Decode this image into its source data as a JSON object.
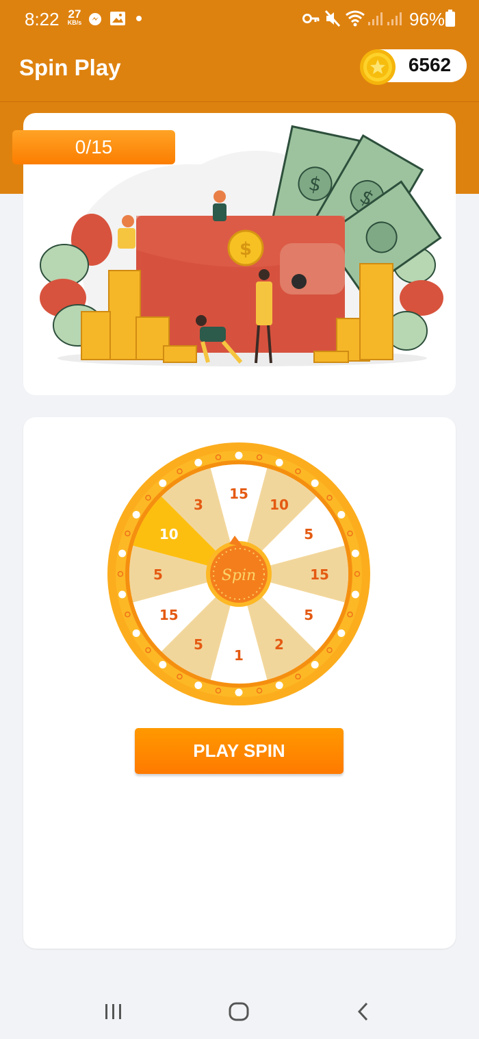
{
  "status_bar": {
    "time": "8:22",
    "net_speed": "27",
    "net_speed_unit": "KB/s",
    "battery": "96%",
    "icons": [
      "messenger-icon",
      "gallery-icon",
      "dot-icon",
      "key-icon",
      "mute-icon",
      "wifi-icon",
      "signal-icon",
      "signal-icon",
      "battery-icon"
    ]
  },
  "app_bar": {
    "title": "Spin Play",
    "coins": "6562",
    "coin_icon": "gold-star-coin-icon"
  },
  "progress": {
    "label": "0/15",
    "fraction": 0
  },
  "banner": {
    "illustration": "wallet-money-coins-illustration"
  },
  "wheel": {
    "center_label": "Spin",
    "segments": [
      "15",
      "10",
      "5",
      "15",
      "5",
      "2",
      "1",
      "5",
      "15",
      "5",
      "10",
      "3"
    ]
  },
  "play_button": {
    "label": "PLAY SPIN"
  },
  "nav_bar": {
    "icons": [
      "recent-apps-icon",
      "home-icon",
      "back-icon"
    ]
  },
  "colors": {
    "header": "#de820f",
    "accent": "#ff8c00",
    "wheel_rim": "#fbaa19",
    "segment_tan": "#f1d69c",
    "segment_white": "#ffffff",
    "segment_gold": "#fdbf0f",
    "segment_text": "#e45a12",
    "background": "#f1f3f6"
  }
}
